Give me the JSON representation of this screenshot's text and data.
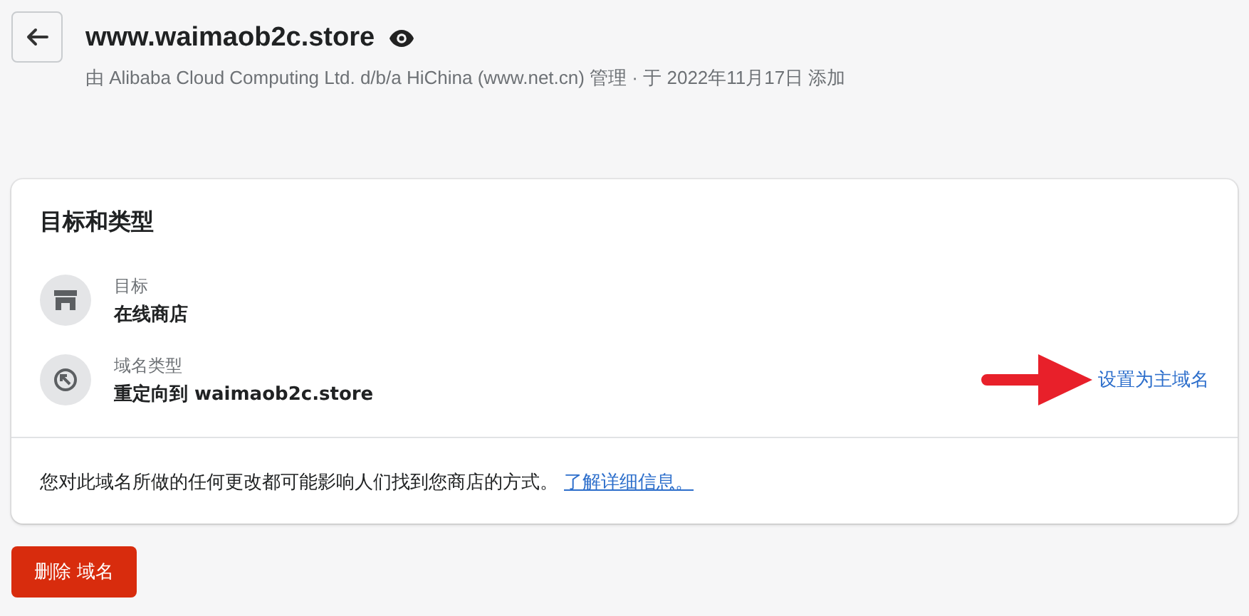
{
  "header": {
    "title": "www.waimaob2c.store",
    "subtitle": "由 Alibaba Cloud Computing Ltd. d/b/a HiChina (www.net.cn) 管理 · 于 2022年11月17日 添加"
  },
  "card": {
    "title": "目标和类型",
    "rows": [
      {
        "kind": "store",
        "label": "目标",
        "value": "在线商店"
      },
      {
        "kind": "redirect",
        "label": "域名类型",
        "value": "重定向到 waimaob2c.store",
        "action": "设置为主域名",
        "annotated": true
      }
    ],
    "footer": {
      "text": "您对此域名所做的任何更改都可能影响人们找到您商店的方式。",
      "link": "了解详细信息。"
    }
  },
  "delete_button": "删除 域名"
}
